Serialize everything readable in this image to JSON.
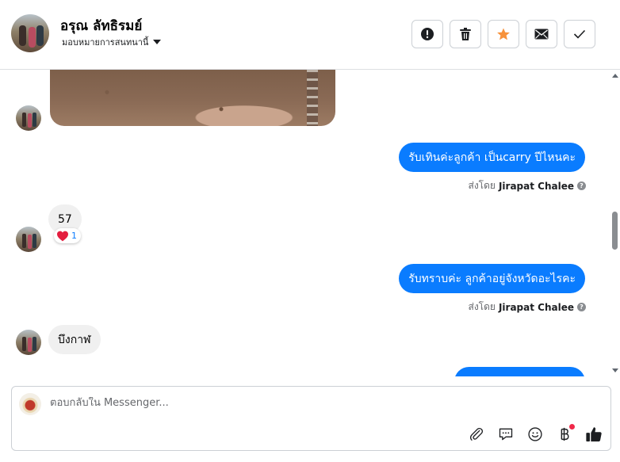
{
  "header": {
    "contact_name": "อรุณ ลัทธิรมย์",
    "assign_label": "มอบหมายการสนทนานี้",
    "actions": [
      {
        "name": "spam-button",
        "icon": "alert-icon"
      },
      {
        "name": "delete-button",
        "icon": "trash-icon"
      },
      {
        "name": "star-button",
        "icon": "star-icon",
        "color": "#f7923b"
      },
      {
        "name": "mark-unread-button",
        "icon": "envelope-icon"
      },
      {
        "name": "mark-done-button",
        "icon": "check-icon"
      }
    ]
  },
  "messages": [
    {
      "type": "image",
      "from": "customer"
    },
    {
      "type": "text",
      "from": "page",
      "text": "รับเทินค่ะลูกค้า เป็นcarry ปีไหนคะ",
      "sent_by_prefix": "ส่งโดย",
      "sent_by": "Jirapat Chalee"
    },
    {
      "type": "text",
      "from": "customer",
      "text": "57",
      "reaction_count": "1"
    },
    {
      "type": "text",
      "from": "page",
      "text": "รับทราบค่ะ ลูกค้าอยู่จังหวัดอะไรคะ",
      "sent_by_prefix": "ส่งโดย",
      "sent_by": "Jirapat Chalee"
    },
    {
      "type": "text",
      "from": "customer",
      "text": "บึงกาฬ"
    },
    {
      "type": "text",
      "from": "page",
      "text": "",
      "partial": true
    }
  ],
  "composer": {
    "placeholder": "ตอบกลับใน Messenger...",
    "tools": [
      "paperclip-icon",
      "chat-bubble-icon",
      "smiley-icon",
      "baht-icon",
      "thumbs-up-icon"
    ]
  },
  "colors": {
    "accent": "#0a7cff",
    "incoming_bubble": "#f0f0f0",
    "star": "#f7923b",
    "notification_dot": "#f02849"
  }
}
